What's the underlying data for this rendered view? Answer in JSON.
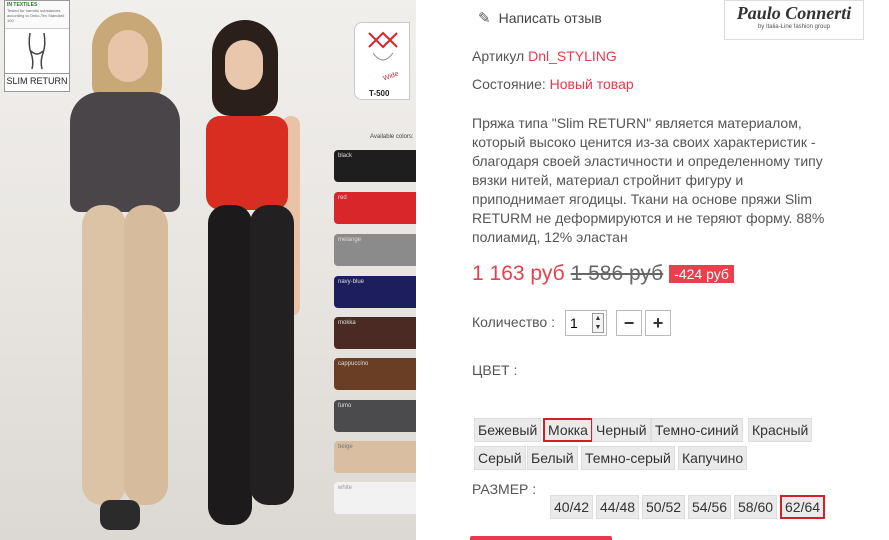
{
  "review": {
    "icon": "pencil-icon",
    "label": "Написать отзыв"
  },
  "brand": {
    "name": "Paulo Connerti",
    "tagline": "by Italia-Line fashion group"
  },
  "article": {
    "label": "Артикул",
    "value": "Dnl_STYLING"
  },
  "condition": {
    "label": "Состояние:",
    "value": "Новый товар"
  },
  "description": "Пряжа типа \"Slim RETURN\" является материалом, который высоко ценится из-за своих характеристик - благодаря своей эластичности и определенному типу вязки нитей, материал стройнит фигуру и приподнимает ягодицы. Ткани на основе пряжи Slim RETURM не деформируются и не теряют форму. 88% полиамид, 12% эластан",
  "price": {
    "current": "1 163 руб",
    "old": "1 586 руб",
    "discount": "-424 руб"
  },
  "quantity": {
    "label": "Количество :",
    "value": "1",
    "minus": "−",
    "plus": "+"
  },
  "color": {
    "label": "ЦВЕТ :",
    "options": [
      "Бежевый",
      "Мокка",
      "Черный",
      "Темно-синий",
      "Красный",
      "Серый",
      "Белый",
      "Темно-серый",
      "Капучино"
    ],
    "selected": "Мокка"
  },
  "size": {
    "label": "РАЗМЕР :",
    "options": [
      "40/42",
      "44/48",
      "50/52",
      "54/56",
      "58/60",
      "62/64"
    ],
    "selected": "62/64"
  },
  "image": {
    "label_card": {
      "text": "SLIM RETURN",
      "cert_title": "IN TEXTILES",
      "cert_text": "Tested for harmful substances according to Oeko-Tex Standard 100"
    },
    "tag": {
      "wide": "Wide",
      "code": "T-500"
    },
    "colors_title": "Available colors:",
    "swatches": [
      {
        "name": "black",
        "color": "#1e1e1e"
      },
      {
        "name": "red",
        "color": "#d8262a"
      },
      {
        "name": "melange",
        "color": "#8b8b8b"
      },
      {
        "name": "navy-blue",
        "color": "#1c1f5c"
      },
      {
        "name": "mokka",
        "color": "#4a2a22"
      },
      {
        "name": "cappuccino",
        "color": "#6a3e24"
      },
      {
        "name": "fumo",
        "color": "#4b4b4d"
      },
      {
        "name": "beige",
        "color": "#d9bea2"
      },
      {
        "name": "white",
        "color": "#f2f2f2"
      }
    ]
  }
}
